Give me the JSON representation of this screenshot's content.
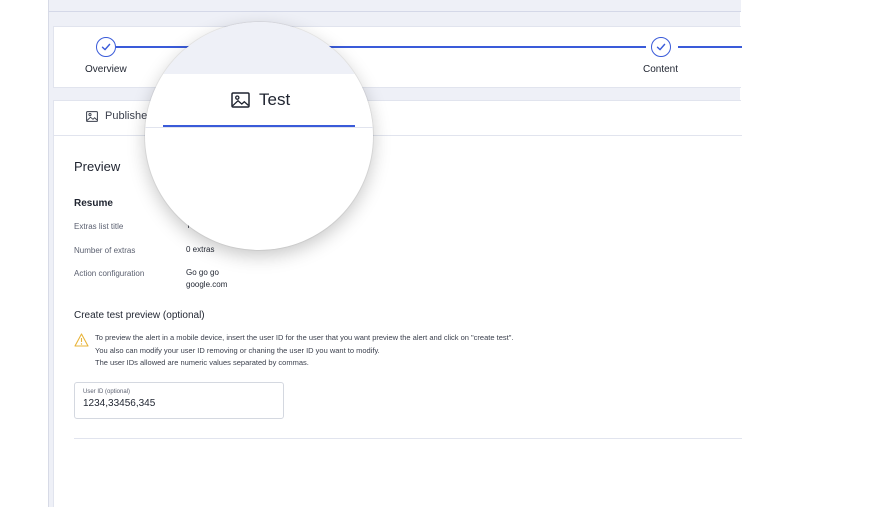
{
  "stepper": {
    "steps": [
      {
        "label": "Overview",
        "icon": "check-circle-icon"
      },
      {
        "label": "Content",
        "icon": "check-circle-icon"
      }
    ]
  },
  "tabs": [
    {
      "label": "Publishe",
      "icon": "image-icon"
    }
  ],
  "magnifier": {
    "tab_label": "Test",
    "tab_icon": "image-icon"
  },
  "preview": {
    "title": "Preview",
    "resume_title": "Resume",
    "rows": [
      {
        "label": "Extras list title",
        "value": "T"
      },
      {
        "label": "Number of extras",
        "value": "0 extras"
      },
      {
        "label": "Action configuration",
        "value": "Go go go",
        "value2": "google.com"
      }
    ]
  },
  "test_preview": {
    "title": "Create test preview (optional)",
    "warning_icon": "warning-icon",
    "warning_lines": [
      "To preview the alert in a mobile device, insert the user ID for the user that you want preview the alert and click on \"create test\".",
      "You also can modify your user ID removing or chaning the user ID you want to modify.",
      "The user IDs allowed are numeric values separated by commas."
    ],
    "input_label": "User ID (optional)",
    "input_value": "1234,33456,345"
  },
  "colors": {
    "accent": "#3a5bd9",
    "background": "#eef0f7",
    "warning": "#e8b43a"
  }
}
